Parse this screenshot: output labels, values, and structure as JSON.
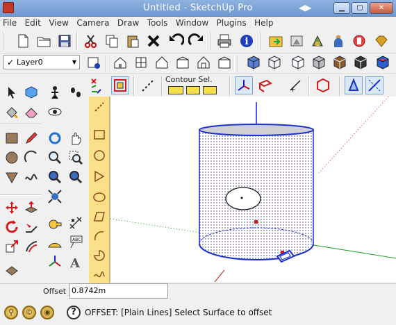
{
  "window": {
    "title": "Untitled - SketchUp Pro",
    "nav_arrows": "◀▶",
    "min_glyph": "▁",
    "max_glyph": "▢",
    "close_glyph": "✕"
  },
  "menu": {
    "items": [
      "File",
      "Edit",
      "View",
      "Camera",
      "Draw",
      "Tools",
      "Window",
      "Plugins",
      "Help"
    ]
  },
  "layer": {
    "check": "✓",
    "value": "Layer0",
    "arrow": "▼"
  },
  "toolbar": {
    "contour_label": "Contour Sel."
  },
  "status": {
    "offset_label": "Offset",
    "offset_value": "0.8742m",
    "message": "OFFSET: [Plain Lines] Select Surface to offset",
    "help_glyph": "?"
  },
  "icons": {
    "new": "new-file-icon",
    "open": "open-folder-icon",
    "save": "save-icon",
    "cut": "scissors-icon",
    "copy": "copy-icon",
    "paste": "paste-icon",
    "erase": "erase-x-icon",
    "undo": "undo-icon",
    "redo": "redo-icon",
    "print": "print-icon",
    "info": "info-icon"
  },
  "colors": {
    "blue_axis": "#1a1adb",
    "red_axis": "#d11a1a",
    "green_axis": "#1a9a1a",
    "cylinder_fill": "#e8e8f4",
    "selection_blue": "#1a2fd0"
  }
}
